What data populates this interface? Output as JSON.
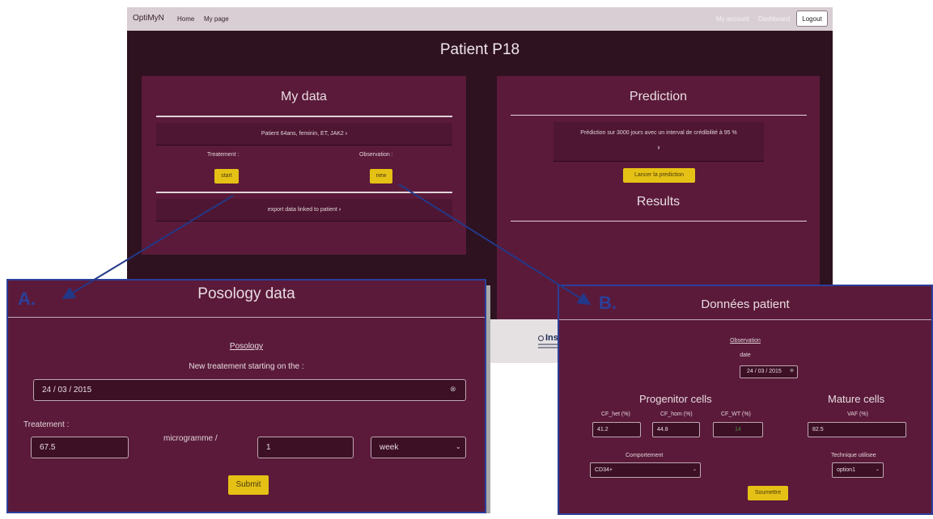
{
  "navbar": {
    "brand": "OptiMyN",
    "links": [
      "Home",
      "My page"
    ],
    "my_account": "My account",
    "dashboard": "Dashboard",
    "logout": "Logout"
  },
  "page_title": "Patient P18",
  "my_data": {
    "title": "My data",
    "patient_info": "Patient 64ans, feminin, ET, JAK2",
    "treatment_label": "Treatement :",
    "observation_label": "Observation :",
    "start_button": "start",
    "new_button": "new",
    "export_link": "export data linked to patient"
  },
  "prediction": {
    "title": "Prediction",
    "description": "Prédiction sur 3000 jours avec un interval de crédibilité à 95 %",
    "launch_button": "Lancer la prediction",
    "results_title": "Results"
  },
  "footer": {
    "partial_text": "Ins"
  },
  "panel_a": {
    "tag": "A.",
    "title": "Posology data",
    "section_link": "Posology",
    "start_label": "New treatement starting on the :",
    "date_value": "24 / 03 / 2015",
    "treatment_label": "Treatement :",
    "dose_value": "67.5",
    "unit_label": "microgramme /",
    "frequency_value": "1",
    "period_value": "week",
    "submit_button": "Submit"
  },
  "panel_b": {
    "tag": "B.",
    "title": "Données patient",
    "section_link": "Observation",
    "date_label": "date",
    "date_value": "24 / 03 / 2015",
    "progenitor_title": "Progenitor cells",
    "mature_title": "Mature cells",
    "cf_het_label": "CF_het (%)",
    "cf_hom_label": "CF_hom (%)",
    "cf_wt_label": "CF_WT (%)",
    "vaf_label": "VAF (%)",
    "cf_het_value": "41.2",
    "cf_hom_value": "44.8",
    "cf_wt_value": "14",
    "vaf_value": "82.5",
    "comportement_label": "Comportement",
    "comportement_value": "CD34+",
    "technique_label": "Technique utilisee",
    "technique_value": "option1",
    "submit_button": "Soumettre"
  },
  "colors": {
    "card": "#5b1a3a",
    "background": "#2e1220",
    "button_yellow": "#e5c115",
    "annotation_blue": "#2c3f9a"
  },
  "icons": {
    "chevron": "chevron-right-icon",
    "dropdown": "chevron-down-icon",
    "clear": "clear-icon",
    "arrow": "arrow-icon"
  }
}
